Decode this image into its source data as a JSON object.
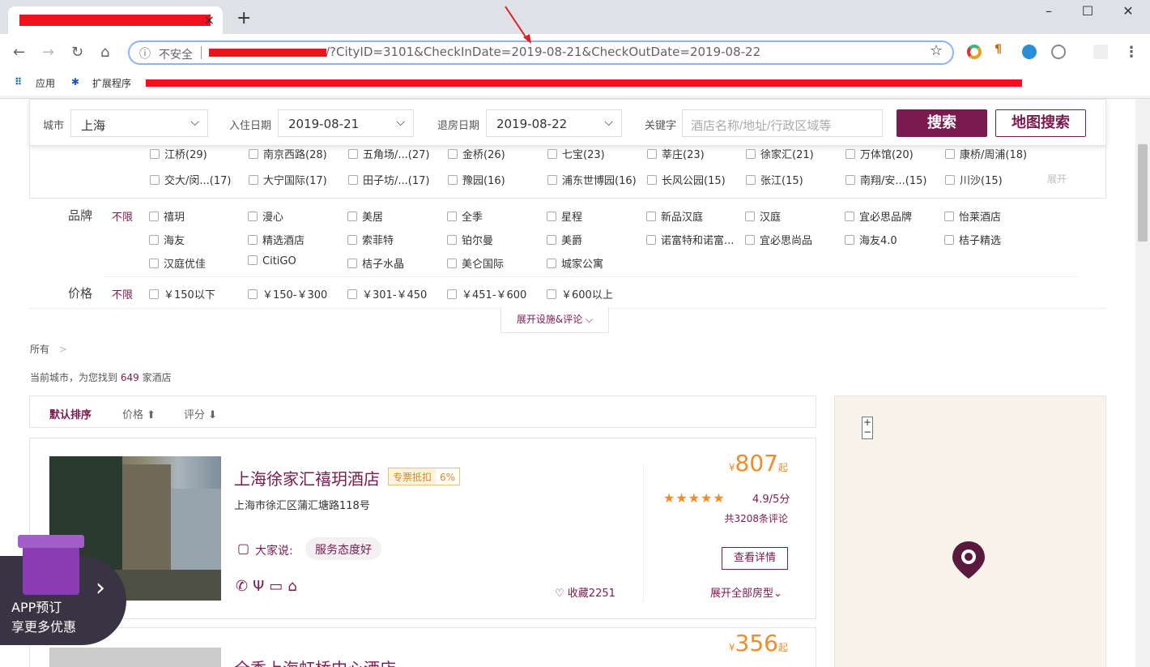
{
  "browser": {
    "new_tab": "+",
    "tab_close": "×",
    "win_min": "–",
    "win_max": "☐",
    "win_close": "✕",
    "insecure_label": "不安全",
    "url_tail": "/?CityID=3101&CheckInDate=2019-08-21&CheckOutDate=2019-08-22",
    "bookmarks": {
      "apps": "应用",
      "extensions": "扩展程序"
    }
  },
  "search": {
    "city_label": "城市",
    "city_value": "上海",
    "checkin_label": "入住日期",
    "checkin_value": "2019-08-21",
    "checkout_label": "退房日期",
    "checkout_value": "2019-08-22",
    "keyword_label": "关键字",
    "keyword_placeholder": "酒店名称/地址/行政区域等",
    "search_button": "搜索",
    "map_search_button": "地图搜索"
  },
  "areas": {
    "row1": [
      "江桥(29)",
      "南京西路(28)",
      "五角场/...(27)",
      "金桥(26)",
      "七宝(23)",
      "莘庄(23)",
      "徐家汇(21)",
      "万体馆(20)",
      "康桥/周浦(18)"
    ],
    "row2": [
      "交大/闵...(17)",
      "大宁国际(17)",
      "田子坊/...(17)",
      "豫园(16)",
      "浦东世博园(16)",
      "长风公园(15)",
      "张江(15)",
      "南翔/安...(15)",
      "川沙(15)"
    ],
    "expand": "展开"
  },
  "brand": {
    "label": "品牌",
    "unlimited": "不限",
    "row1": [
      "禧玥",
      "漫心",
      "美居",
      "全季",
      "星程",
      "新品汉庭",
      "汉庭",
      "宜必思品牌",
      "怡莱酒店"
    ],
    "row2": [
      "海友",
      "精选酒店",
      "索菲特",
      "铂尔曼",
      "美爵",
      "诺富特和诺富...",
      "宜必思尚品",
      "海友4.0",
      "桔子精选"
    ],
    "row3": [
      "汉庭优佳",
      "CitiGO",
      "桔子水晶",
      "美仑国际",
      "城家公寓"
    ]
  },
  "price_filter": {
    "label": "价格",
    "unlimited": "不限",
    "options": [
      "￥150以下",
      "￥150-￥300",
      "￥301-￥450",
      "￥451-￥600",
      "￥600以上"
    ]
  },
  "expand_facilities": "展开设施&评论 ⌵",
  "breadcrumb": "所有",
  "breadcrumb_arrow": ">",
  "results": {
    "prefix": "当前城市，为您找到",
    "count": "649",
    "suffix": "家酒店"
  },
  "sort": {
    "default": "默认排序",
    "price": "价格 ⬆",
    "rating": "评分 ⬇"
  },
  "hotels": [
    {
      "name": "上海徐家汇禧玥酒店",
      "tag": "专票抵扣",
      "tag_pct": "6%",
      "address": "上海市徐汇区蒲汇塘路118号",
      "says_label": "大家说:",
      "says_tag": "服务态度好",
      "facility_icons": [
        "wifi-icon",
        "restaurant-icon",
        "meeting-icon",
        "parking-icon"
      ],
      "favorites": "收藏2251",
      "currency": "¥",
      "price": "807",
      "price_suffix": "起",
      "stars": "★★★★★",
      "rating": 4.9,
      "score": "4.9/5分",
      "reviews": "共3208条评论",
      "detail_button": "查看详情",
      "all_rooms": "展开全部房型⌄"
    },
    {
      "name": "全季上海虹桥中心酒店",
      "currency": "¥",
      "price": "356",
      "price_suffix": "起"
    }
  ],
  "promo": {
    "line1": "APP预订",
    "line2": "享更多优惠"
  },
  "map": {
    "zoom_in": "+",
    "zoom_out": "−"
  },
  "colors": {
    "brand": "#7a1a4f",
    "price": "#f08c2a",
    "redaction": "#f0121a"
  }
}
